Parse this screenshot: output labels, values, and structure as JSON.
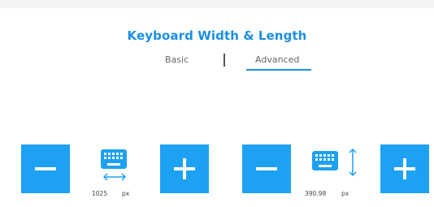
{
  "page": {
    "title": "Keyboard Width & Length"
  },
  "tabs": [
    {
      "label": "Basic",
      "active": false
    },
    {
      "label": "Advanced",
      "active": true
    }
  ],
  "width_control": {
    "value": "1025",
    "unit": "px"
  },
  "length_control": {
    "value": "390.98",
    "unit": "px"
  },
  "colors": {
    "accent": "#1da1f2",
    "title": "#1a8fe3",
    "background": "#ffffff",
    "page_background": "#f3f3f3"
  },
  "icons": {
    "decrease": "minus-icon",
    "increase": "plus-icon",
    "keyboard": "keyboard-icon",
    "width_arrow": "horizontal-double-arrow-icon",
    "length_arrow": "vertical-double-arrow-icon"
  }
}
